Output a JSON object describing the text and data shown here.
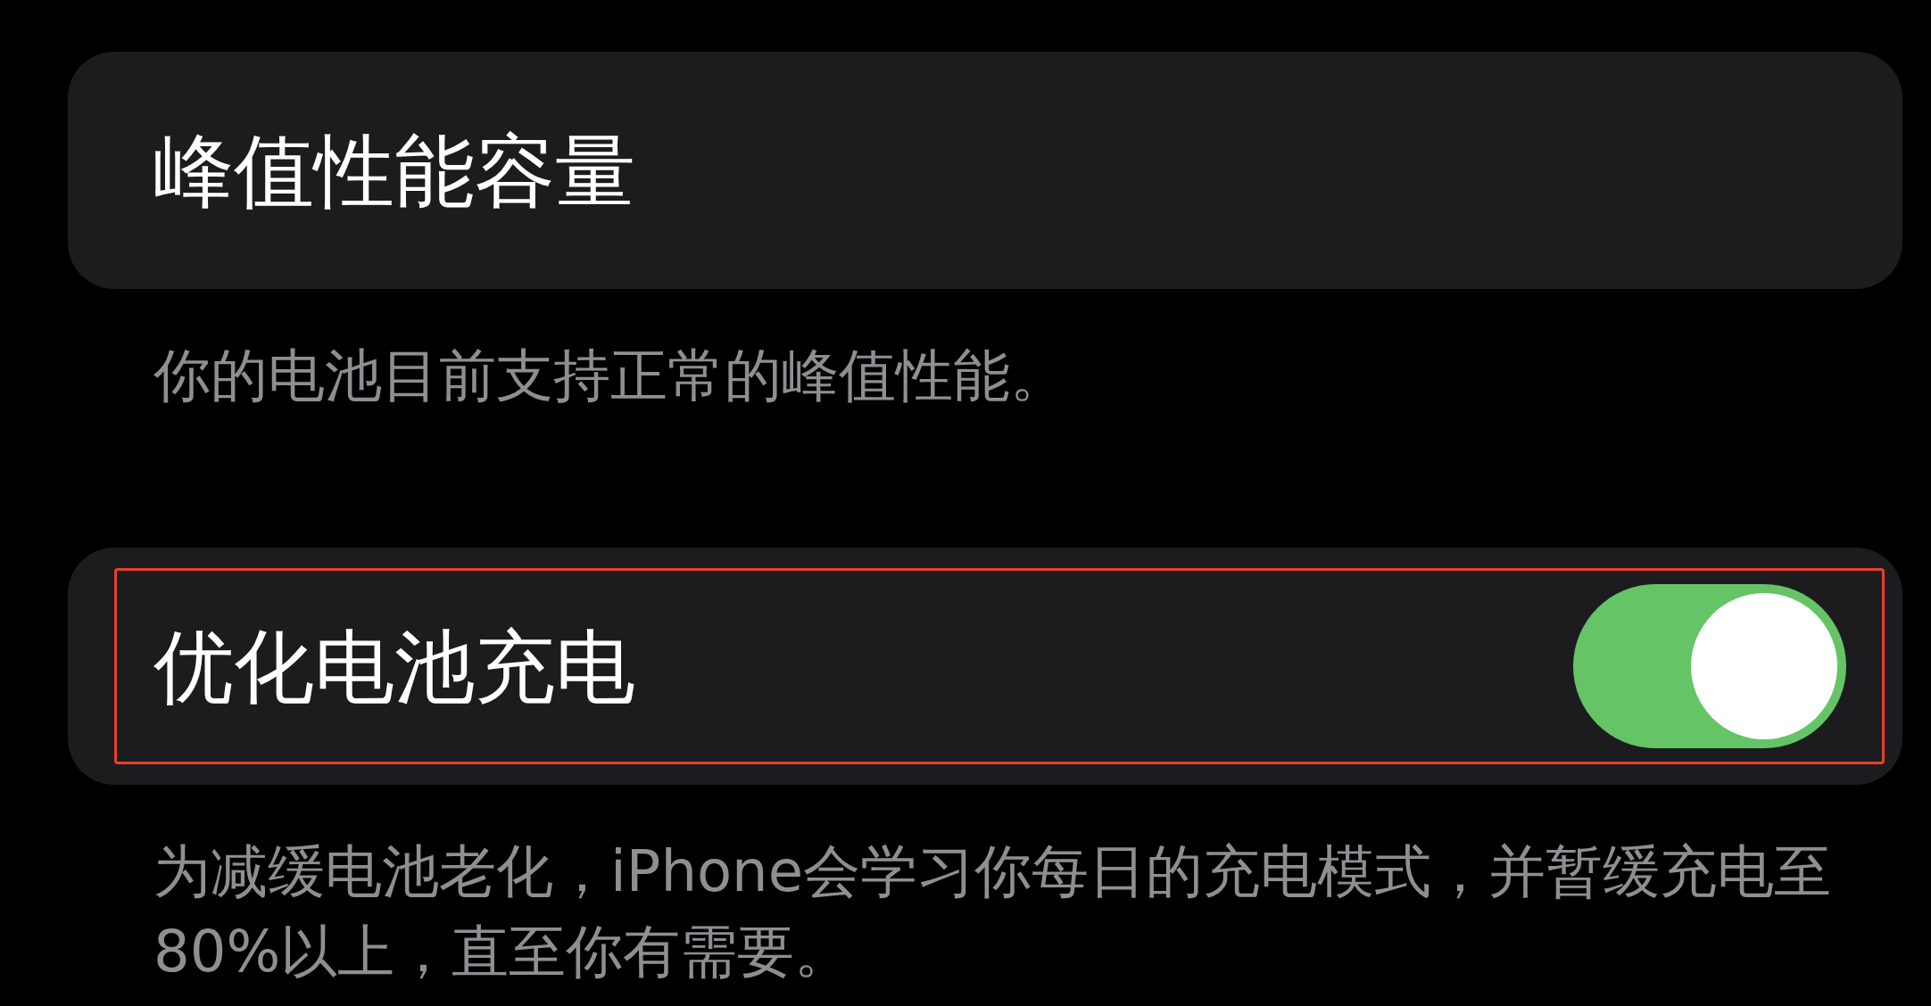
{
  "peak_performance": {
    "title": "峰值性能容量",
    "footer": "你的电池目前支持正常的峰值性能。"
  },
  "optimized_charging": {
    "label": "优化电池充电",
    "on": true,
    "highlighted": true,
    "footer": "为减缓电池老化，iPhone会学习你每日的充电模式，并暂缓充电至80%以上，直至你有需要。"
  }
}
